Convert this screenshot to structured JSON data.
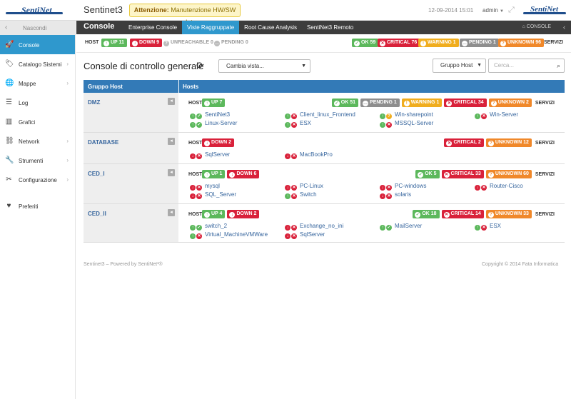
{
  "header": {
    "app_title": "Sentinet3",
    "logo_text": "SentiNet",
    "alert_label": "Attenzione:",
    "alert_text": "Manutenzione HW/SW scaduta",
    "datetime": "12-09-2014 15:01",
    "user": "admin",
    "logo2_text": "SentiNet"
  },
  "sidebar": {
    "hide_label": "Nascondi",
    "items": [
      {
        "label": "Console",
        "icon": "rocket-icon",
        "glyph": "🚀",
        "active": true,
        "chevron": false
      },
      {
        "label": "Catalogo Sistemi",
        "icon": "tag-icon",
        "glyph": "🏷",
        "chevron": true
      },
      {
        "label": "Mappe",
        "icon": "globe-icon",
        "glyph": "🌐",
        "chevron": true
      },
      {
        "label": "Log",
        "icon": "list-icon",
        "glyph": "☰",
        "chevron": false
      },
      {
        "label": "Grafici",
        "icon": "chart-icon",
        "glyph": "▥",
        "chevron": false
      },
      {
        "label": "Network",
        "icon": "network-icon",
        "glyph": "⛓",
        "chevron": true
      },
      {
        "label": "Strumenti",
        "icon": "wrench-icon",
        "glyph": "🔧",
        "chevron": true
      },
      {
        "label": "Configurazione",
        "icon": "tools-icon",
        "glyph": "✂",
        "chevron": true
      },
      {
        "label": "Preferiti",
        "icon": "heart-icon",
        "glyph": "♥",
        "chevron": false
      }
    ]
  },
  "navbar": {
    "brand": "Console",
    "tabs": [
      {
        "label": "Enterprise Console",
        "active": false
      },
      {
        "label": "Viste Raggruppate",
        "active": true
      },
      {
        "label": "Root Cause Analysis",
        "active": false
      },
      {
        "label": "SentiNet3 Remoto",
        "active": false
      }
    ],
    "crumb": "CONSOLE"
  },
  "status": {
    "host_label": "HOST",
    "up": "UP 11",
    "down": "DOWN 9",
    "unreachable": "UNREACHABLE 0",
    "pending": "PENDING 0",
    "ok": "OK 59",
    "critical": "CRITICAL 76",
    "warning": "WARNING 1",
    "svc_pending": "PENDING 1",
    "unknown": "UNKNOWN 96",
    "services_label": "SERVIZI"
  },
  "main": {
    "title": "Console di controllo generale",
    "view_select": "Cambia vista...",
    "group_select": "Gruppo Host",
    "search_placeholder": "Cerca..."
  },
  "table": {
    "col_group": "Gruppo Host",
    "col_hosts": "Hosts",
    "host_label": "HOST",
    "services_label": "SERVIZI",
    "groups": [
      {
        "name": "DMZ",
        "host_badges": [
          {
            "text": "UP 7",
            "color": "g",
            "icon": "↑"
          }
        ],
        "svc_badges": [
          {
            "text": "OK 51",
            "color": "g",
            "icon": "✓"
          },
          {
            "text": "PENDING 1",
            "color": "gr",
            "icon": "…"
          },
          {
            "text": "WARNING 1",
            "color": "y",
            "icon": "!"
          },
          {
            "text": "CRITICAL 34",
            "color": "r",
            "icon": "✕"
          },
          {
            "text": "UNKNOWN 2",
            "color": "o",
            "icon": "?"
          }
        ],
        "hosts": [
          {
            "name": "SentiNet3",
            "h": "up",
            "s": "up"
          },
          {
            "name": "Client_linux_Frontend",
            "h": "up",
            "s": "dn"
          },
          {
            "name": "Win-sharepoint",
            "h": "up",
            "s": "wa"
          },
          {
            "name": "Win-Server",
            "h": "up",
            "s": "dn"
          },
          {
            "name": "Linux-Server",
            "h": "up",
            "s": "up"
          },
          {
            "name": "ESX",
            "h": "up",
            "s": "dn"
          },
          {
            "name": "MSSQL-Server",
            "h": "up",
            "s": "dn"
          }
        ]
      },
      {
        "name": "DATABASE",
        "host_badges": [
          {
            "text": "DOWN 2",
            "color": "r",
            "icon": "↓"
          }
        ],
        "svc_badges": [
          {
            "text": "CRITICAL 2",
            "color": "r",
            "icon": "✕"
          },
          {
            "text": "UNKNOWN 12",
            "color": "o",
            "icon": "?"
          }
        ],
        "hosts": [
          {
            "name": "SqlServer",
            "h": "dn",
            "s": "dn"
          },
          {
            "name": "MacBookPro",
            "h": "dn",
            "s": "dn"
          }
        ]
      },
      {
        "name": "CED_I",
        "host_badges": [
          {
            "text": "UP 1",
            "color": "g",
            "icon": "↑"
          },
          {
            "text": "DOWN 6",
            "color": "r",
            "icon": "↓"
          }
        ],
        "svc_badges": [
          {
            "text": "OK 5",
            "color": "g",
            "icon": "✓"
          },
          {
            "text": "CRITICAL 33",
            "color": "r",
            "icon": "✕"
          },
          {
            "text": "UNKNOWN 60",
            "color": "o",
            "icon": "?"
          }
        ],
        "hosts": [
          {
            "name": "mysql",
            "h": "dn",
            "s": "dn"
          },
          {
            "name": "PC-Linux",
            "h": "dn",
            "s": "dn"
          },
          {
            "name": "PC-windows",
            "h": "dn",
            "s": "dn"
          },
          {
            "name": "Router-Cisco",
            "h": "dn",
            "s": "dn"
          },
          {
            "name": "SQL_Server",
            "h": "dn",
            "s": "dn"
          },
          {
            "name": "Switch",
            "h": "up",
            "s": "dn"
          },
          {
            "name": "solaris",
            "h": "dn",
            "s": "dn"
          }
        ]
      },
      {
        "name": "CED_II",
        "host_badges": [
          {
            "text": "UP 4",
            "color": "g",
            "icon": "↑"
          },
          {
            "text": "DOWN 2",
            "color": "r",
            "icon": "↓"
          }
        ],
        "svc_badges": [
          {
            "text": "OK 18",
            "color": "g",
            "icon": "✓"
          },
          {
            "text": "CRITICAL 14",
            "color": "r",
            "icon": "✕"
          },
          {
            "text": "UNKNOWN 33",
            "color": "o",
            "icon": "?"
          }
        ],
        "hosts": [
          {
            "name": "switch_2",
            "h": "up",
            "s": "up"
          },
          {
            "name": "Exchange_no_ini",
            "h": "dn",
            "s": "dn"
          },
          {
            "name": "MailServer",
            "h": "up",
            "s": "up"
          },
          {
            "name": "ESX",
            "h": "up",
            "s": "dn"
          },
          {
            "name": "Virtual_MachineVMWare",
            "h": "up",
            "s": "dn"
          },
          {
            "name": "SqlServer",
            "h": "dn",
            "s": "dn"
          }
        ]
      }
    ]
  },
  "footer": {
    "left": "Sentinet3 – Powered by SentiNet³®",
    "right": "Copyright © 2014 Fata Informatica"
  }
}
